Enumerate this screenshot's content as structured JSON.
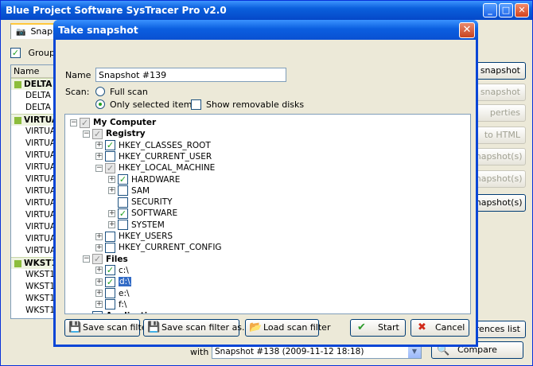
{
  "main": {
    "title": "Blue Project Software SysTracer Pro v2.0",
    "tab_label": "Snaps",
    "group_check_label": "Group sna",
    "list_header": "Name",
    "list_rows": [
      {
        "text": "DELTA",
        "group": true
      },
      {
        "text": "DELTA -",
        "group": false
      },
      {
        "text": "DELTA -",
        "group": false
      },
      {
        "text": "VIRTUA",
        "group": true
      },
      {
        "text": "VIRTUA",
        "group": false
      },
      {
        "text": "VIRTUA",
        "group": false
      },
      {
        "text": "VIRTUA",
        "group": false
      },
      {
        "text": "VIRTUA",
        "group": false
      },
      {
        "text": "VIRTUA",
        "group": false
      },
      {
        "text": "VIRTUA",
        "group": false
      },
      {
        "text": "VIRTUA",
        "group": false
      },
      {
        "text": "VIRTUA",
        "group": false
      },
      {
        "text": "VIRTUA",
        "group": false
      },
      {
        "text": "VIRTUA",
        "group": false
      },
      {
        "text": "VIRTUA",
        "group": false
      },
      {
        "text": "WKST1",
        "group": true
      },
      {
        "text": "WKST1",
        "group": false
      },
      {
        "text": "WKST1",
        "group": false
      },
      {
        "text": "WKST1",
        "group": false
      },
      {
        "text": "WKST1",
        "group": false
      }
    ],
    "side_buttons": [
      {
        "label": "snapshot",
        "enabled": true
      },
      {
        "label": "snapshot",
        "enabled": false
      },
      {
        "label": "perties",
        "enabled": false
      },
      {
        "label": "to HTML",
        "enabled": false
      },
      {
        "label": "snapshot(s)",
        "enabled": false
      },
      {
        "label": "snapshot(s)",
        "enabled": false
      },
      {
        "label": "snapshot(s)",
        "enabled": true
      }
    ],
    "references_label": "erences list",
    "with_label": "with",
    "with_value": "Snapshot #138 (2009-11-12 18:18)",
    "compare_label": "Compare"
  },
  "dialog": {
    "title": "Take snapshot",
    "name_label": "Name",
    "name_value": "Snapshot #139",
    "scan_label": "Scan:",
    "full_scan_label": "Full scan",
    "only_selected_label": "Only selected items",
    "show_removable_label": "Show removable disks",
    "selected_scan": "only_selected",
    "tree": [
      {
        "label": "My Computer",
        "level": 0,
        "check": "gray",
        "expander": "minus",
        "bold": true,
        "highlight": false
      },
      {
        "label": "Registry",
        "level": 1,
        "check": "gray",
        "expander": "minus",
        "bold": true,
        "highlight": false
      },
      {
        "label": "HKEY_CLASSES_ROOT",
        "level": 2,
        "check": "checked",
        "expander": "plus",
        "bold": false,
        "highlight": false
      },
      {
        "label": "HKEY_CURRENT_USER",
        "level": 2,
        "check": "unchecked",
        "expander": "plus",
        "bold": false,
        "highlight": false
      },
      {
        "label": "HKEY_LOCAL_MACHINE",
        "level": 2,
        "check": "gray",
        "expander": "minus",
        "bold": false,
        "highlight": false
      },
      {
        "label": "HARDWARE",
        "level": 3,
        "check": "checked",
        "expander": "plus",
        "bold": false,
        "highlight": false
      },
      {
        "label": "SAM",
        "level": 3,
        "check": "unchecked",
        "expander": "plus",
        "bold": false,
        "highlight": false
      },
      {
        "label": "SECURITY",
        "level": 3,
        "check": "unchecked",
        "expander": "none",
        "bold": false,
        "highlight": false
      },
      {
        "label": "SOFTWARE",
        "level": 3,
        "check": "checked",
        "expander": "plus",
        "bold": false,
        "highlight": false
      },
      {
        "label": "SYSTEM",
        "level": 3,
        "check": "unchecked",
        "expander": "plus",
        "bold": false,
        "highlight": false
      },
      {
        "label": "HKEY_USERS",
        "level": 2,
        "check": "unchecked",
        "expander": "plus",
        "bold": false,
        "highlight": false
      },
      {
        "label": "HKEY_CURRENT_CONFIG",
        "level": 2,
        "check": "unchecked",
        "expander": "plus",
        "bold": false,
        "highlight": false
      },
      {
        "label": "Files",
        "level": 1,
        "check": "gray",
        "expander": "minus",
        "bold": true,
        "highlight": false
      },
      {
        "label": "c:\\",
        "level": 2,
        "check": "checked",
        "expander": "plus",
        "bold": false,
        "highlight": false
      },
      {
        "label": "d:\\",
        "level": 2,
        "check": "checked",
        "expander": "plus",
        "bold": false,
        "highlight": true
      },
      {
        "label": "e:\\",
        "level": 2,
        "check": "unchecked",
        "expander": "plus",
        "bold": false,
        "highlight": false
      },
      {
        "label": "f:\\",
        "level": 2,
        "check": "unchecked",
        "expander": "plus",
        "bold": false,
        "highlight": false
      },
      {
        "label": "Applications",
        "level": 1,
        "check": "checked",
        "expander": "none",
        "bold": true,
        "highlight": false
      }
    ],
    "buttons": {
      "save_filter": "Save scan filter",
      "save_filter_as": "Save scan filter as...",
      "load_filter": "Load scan filter",
      "start": "Start",
      "cancel": "Cancel"
    }
  }
}
